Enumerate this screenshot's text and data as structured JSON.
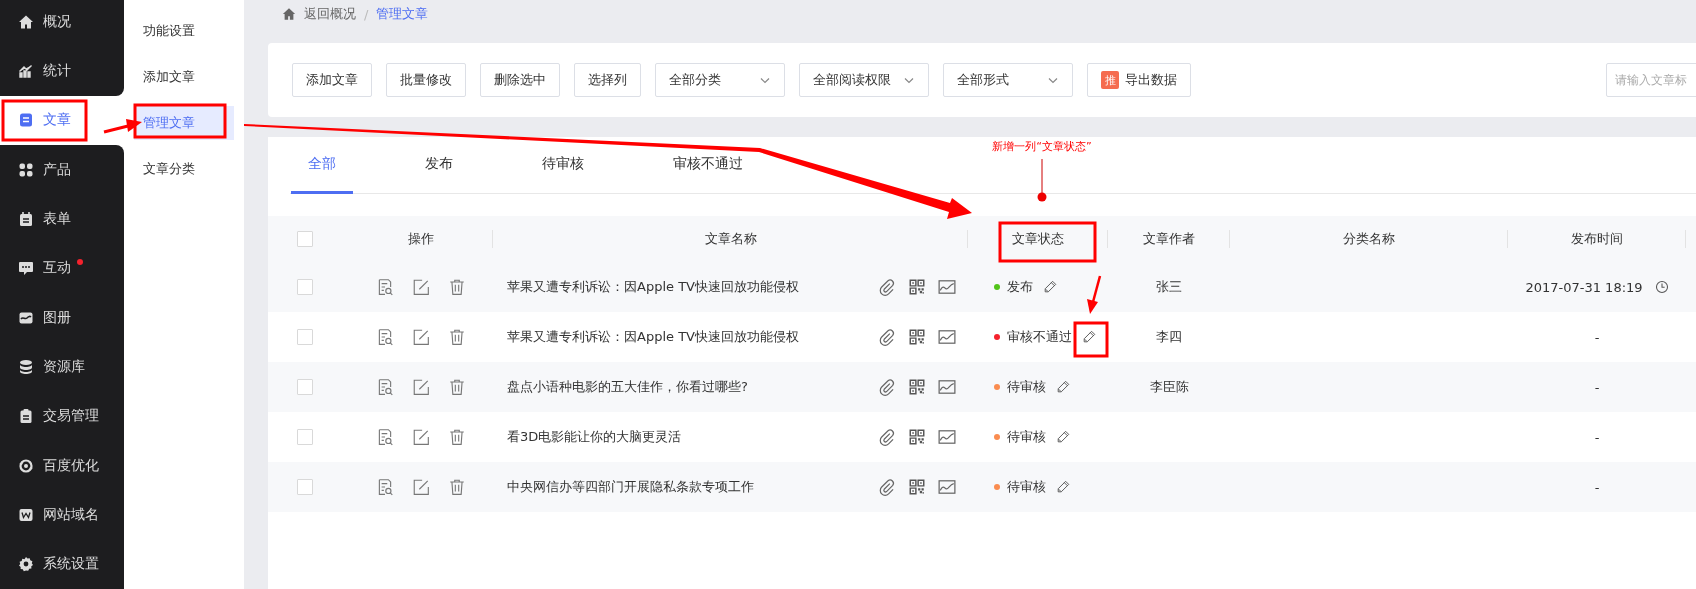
{
  "sidebar": {
    "items": [
      {
        "label": "概况",
        "selected": false,
        "badge": false
      },
      {
        "label": "统计",
        "selected": false,
        "badge": false
      },
      {
        "label": "文章",
        "selected": true,
        "badge": false
      },
      {
        "label": "产品",
        "selected": false,
        "badge": false
      },
      {
        "label": "表单",
        "selected": false,
        "badge": false
      },
      {
        "label": "互动",
        "selected": false,
        "badge": true
      },
      {
        "label": "图册",
        "selected": false,
        "badge": false
      },
      {
        "label": "资源库",
        "selected": false,
        "badge": false
      },
      {
        "label": "交易管理",
        "selected": false,
        "badge": false
      },
      {
        "label": "百度优化",
        "selected": false,
        "badge": false
      },
      {
        "label": "网站域名",
        "selected": false,
        "badge": false
      },
      {
        "label": "系统设置",
        "selected": false,
        "badge": false
      }
    ]
  },
  "subnav": {
    "items": [
      {
        "label": "功能设置",
        "selected": false
      },
      {
        "label": "添加文章",
        "selected": false
      },
      {
        "label": "管理文章",
        "selected": true
      },
      {
        "label": "文章分类",
        "selected": false
      }
    ]
  },
  "breadcrumb": {
    "back": "返回概况",
    "separator": "/",
    "current": "管理文章"
  },
  "toolbar": {
    "buttons": [
      "添加文章",
      "批量修改",
      "删除选中",
      "选择列"
    ],
    "dropdowns": [
      "全部分类",
      "全部阅读权限",
      "全部形式"
    ],
    "export": {
      "badge": "推",
      "label": "导出数据"
    },
    "search": {
      "placeholder": "请输入文章标"
    }
  },
  "tabs": [
    {
      "label": "全部",
      "selected": true
    },
    {
      "label": "发布",
      "selected": false
    },
    {
      "label": "待审核",
      "selected": false
    },
    {
      "label": "审核不通过",
      "selected": false
    }
  ],
  "annotation": {
    "note": "新增一列“文章状态”"
  },
  "table": {
    "select_all": false,
    "columns": [
      "操作",
      "文章名称",
      "文章状态",
      "文章作者",
      "分类名称",
      "发布时间"
    ],
    "rows": [
      {
        "checked": false,
        "title": "苹果又遭专利诉讼：因Apple TV快速回放功能侵权",
        "status": "发布",
        "color": "#52c41a",
        "author": "张三",
        "time": "2017-07-31 18:19",
        "scheduled": true
      },
      {
        "checked": false,
        "title": "苹果又遭专利诉讼：因Apple TV快速回放功能侵权",
        "status": "审核不通过",
        "color": "#f5222d",
        "author": "李四",
        "time": "-",
        "scheduled": false
      },
      {
        "checked": false,
        "title": "盘点小语种电影的五大佳作，你看过哪些?",
        "status": "待审核",
        "color": "#fa8c50",
        "author": "李臣陈",
        "time": "-",
        "scheduled": false
      },
      {
        "checked": false,
        "title": "看3D电影能让你的大脑更灵活",
        "status": "待审核",
        "color": "#fa8c50",
        "time": "-",
        "scheduled": false
      },
      {
        "checked": false,
        "title": "中央网信办等四部门开展隐私条款专项工作",
        "status": "待审核",
        "color": "#fa8c50",
        "time": "-",
        "scheduled": false
      }
    ]
  }
}
